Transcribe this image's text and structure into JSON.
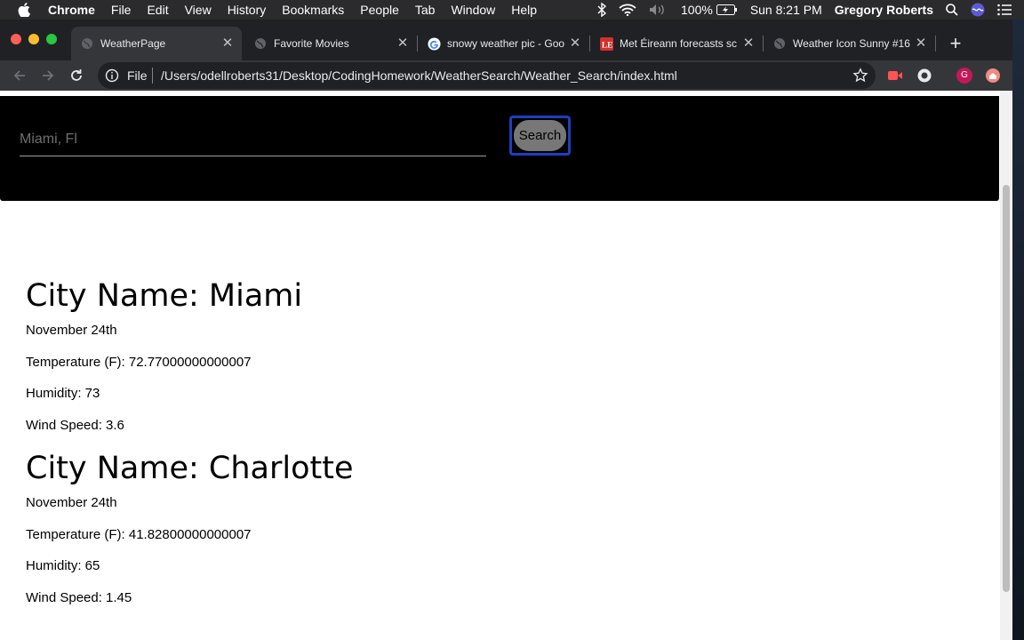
{
  "menubar": {
    "app": "Chrome",
    "items": [
      "File",
      "Edit",
      "View",
      "History",
      "Bookmarks",
      "People",
      "Tab",
      "Window",
      "Help"
    ],
    "battery": "100%",
    "clock": "Sun 8:21 PM",
    "user": "Gregory Roberts"
  },
  "tabs": [
    {
      "title": "WeatherPage",
      "icon": "globe-icon",
      "active": true
    },
    {
      "title": "Favorite Movies",
      "icon": "globe-icon",
      "active": false
    },
    {
      "title": "snowy weather pic - Goo",
      "icon": "google-icon",
      "active": false
    },
    {
      "title": "Met Éireann forecasts sc",
      "icon": "le-icon",
      "active": false
    },
    {
      "title": "Weather Icon Sunny #16",
      "icon": "globe-icon",
      "active": false
    }
  ],
  "address": {
    "scheme": "File",
    "url": "/Users/odellroberts31/Desktop/CodingHomework/WeatherSearch/Weather_Search/index.html"
  },
  "profile_initial": "G",
  "page": {
    "search": {
      "placeholder": "Miami, Fl",
      "button_label": "Search"
    },
    "cities": [
      {
        "heading": "City Name: Miami",
        "date": "November 24th",
        "temperature": "Temperature (F): 72.77000000000007",
        "humidity": "Humidity: 73",
        "wind": "Wind Speed: 3.6"
      },
      {
        "heading": "City Name: Charlotte",
        "date": "November 24th",
        "temperature": "Temperature (F): 41.82800000000007",
        "humidity": "Humidity: 65",
        "wind": "Wind Speed: 1.45"
      }
    ]
  },
  "colors": {
    "header_bg": "#000000",
    "button_bg": "#777777",
    "focus_ring": "#1e3fbf",
    "tabstrip_bg": "#202124",
    "toolbar_bg": "#35363a"
  }
}
